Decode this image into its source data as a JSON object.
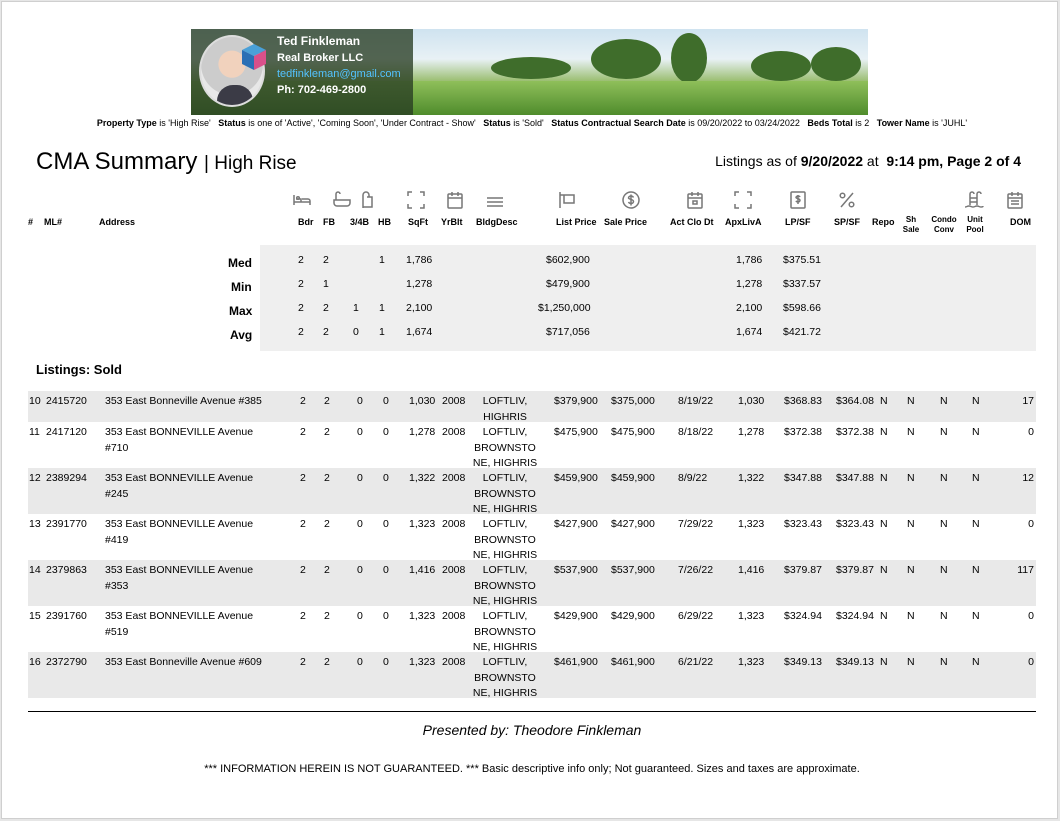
{
  "agent": {
    "name": "Ted Finkleman",
    "brokerage": "Real Broker LLC",
    "email": "tedfinkleman@gmail.com",
    "phone": "Ph: 702-469-2800"
  },
  "criteria": {
    "k1": "Property Type",
    "v1": " is 'High Rise'",
    "k2": "Status",
    "v2": " is one of 'Active', 'Coming Soon', 'Under Contract - Show'",
    "k3": "Status",
    "v3": " is 'Sold'",
    "k4": "Status Contractual Search Date",
    "v4": " is 09/20/2022 to 03/24/2022",
    "k5": "Beds Total",
    "v5": " is 2",
    "k6a": "Tower",
    "k6b": "Name",
    "v6": " is 'JUHL'"
  },
  "title": "CMA Summary",
  "subtitle": "| High Rise",
  "asof": {
    "prefix": "Listings as of ",
    "date": "9/20/2022",
    "mid": " at ",
    "time_page": "9:14 pm, Page 2 of 4"
  },
  "columns": {
    "num": "#",
    "ml": "ML#",
    "address": "Address",
    "bdr": "Bdr",
    "fb": "FB",
    "tqb": "3/4B",
    "hb": "HB",
    "sqft": "SqFt",
    "yrblt": "YrBlt",
    "bldg": "BldgDesc",
    "list": "List Price",
    "sale": "Sale Price",
    "actclo": "Act Clo Dt",
    "apxliva": "ApxLivA",
    "lpsf": "LP/SF",
    "spsf": "SP/SF",
    "repo": "Repo",
    "sh1": "Sh",
    "sh2": "Sale",
    "cc1": "Condo",
    "cc2": "Conv",
    "up1": "Unit",
    "up2": "Pool",
    "dom": "DOM"
  },
  "icons": [
    "bed-icon",
    "bath-icon",
    "shower-icon",
    "sqft-icon",
    "calendar-icon",
    "building-desc-icon",
    "list-price-sign-icon",
    "dollar-circle-icon",
    "close-date-icon",
    "living-area-icon",
    "dollar-doc-icon",
    "percent-icon",
    "pool-icon",
    "dom-calendar-icon"
  ],
  "stats": {
    "med": {
      "label": "Med",
      "bdr": "2",
      "fb": "2",
      "tqb": "",
      "hb": "1",
      "sqft": "1,786",
      "list": "$602,900",
      "apx": "1,786",
      "lpsf": "$375.51"
    },
    "min": {
      "label": "Min",
      "bdr": "2",
      "fb": "1",
      "tqb": "",
      "hb": "",
      "sqft": "1,278",
      "list": "$479,900",
      "apx": "1,278",
      "lpsf": "$337.57"
    },
    "max": {
      "label": "Max",
      "bdr": "2",
      "fb": "2",
      "tqb": "1",
      "hb": "1",
      "sqft": "2,100",
      "list": "$1,250,000",
      "apx": "2,100",
      "lpsf": "$598.66"
    },
    "avg": {
      "label": "Avg",
      "bdr": "2",
      "fb": "2",
      "tqb": "0",
      "hb": "1",
      "sqft": "1,674",
      "list": "$717,056",
      "apx": "1,674",
      "lpsf": "$421.72"
    }
  },
  "section_label": "Listings: Sold",
  "listings": [
    {
      "n": "10",
      "ml": "2415720",
      "addr": "353 East Bonneville Avenue #385",
      "bdr": "2",
      "fb": "2",
      "tqb": "0",
      "hb": "0",
      "sqft": "1,030",
      "yr": "2008",
      "bldg": "LOFTLIV, HIGHRIS",
      "list": "$379,900",
      "sale": "$375,000",
      "clo": "8/19/22",
      "apx": "1,030",
      "lpsf": "$368.83",
      "spsf": "$364.08",
      "repo": "N",
      "sh": "N",
      "cc": "N",
      "up": "N",
      "dom": "17"
    },
    {
      "n": "11",
      "ml": "2417120",
      "addr": "353 East BONNEVILLE Avenue #710",
      "bdr": "2",
      "fb": "2",
      "tqb": "0",
      "hb": "0",
      "sqft": "1,278",
      "yr": "2008",
      "bldg": "LOFTLIV, BROWNSTO NE, HIGHRIS",
      "list": "$475,900",
      "sale": "$475,900",
      "clo": "8/18/22",
      "apx": "1,278",
      "lpsf": "$372.38",
      "spsf": "$372.38",
      "repo": "N",
      "sh": "N",
      "cc": "N",
      "up": "N",
      "dom": "0"
    },
    {
      "n": "12",
      "ml": "2389294",
      "addr": "353 East BONNEVILLE Avenue #245",
      "bdr": "2",
      "fb": "2",
      "tqb": "0",
      "hb": "0",
      "sqft": "1,322",
      "yr": "2008",
      "bldg": "LOFTLIV, BROWNSTO NE, HIGHRIS",
      "list": "$459,900",
      "sale": "$459,900",
      "clo": "8/9/22",
      "apx": "1,322",
      "lpsf": "$347.88",
      "spsf": "$347.88",
      "repo": "N",
      "sh": "N",
      "cc": "N",
      "up": "N",
      "dom": "12"
    },
    {
      "n": "13",
      "ml": "2391770",
      "addr": "353 East BONNEVILLE Avenue #419",
      "bdr": "2",
      "fb": "2",
      "tqb": "0",
      "hb": "0",
      "sqft": "1,323",
      "yr": "2008",
      "bldg": "LOFTLIV, BROWNSTO NE, HIGHRIS",
      "list": "$427,900",
      "sale": "$427,900",
      "clo": "7/29/22",
      "apx": "1,323",
      "lpsf": "$323.43",
      "spsf": "$323.43",
      "repo": "N",
      "sh": "N",
      "cc": "N",
      "up": "N",
      "dom": "0"
    },
    {
      "n": "14",
      "ml": "2379863",
      "addr": "353 East BONNEVILLE Avenue #353",
      "bdr": "2",
      "fb": "2",
      "tqb": "0",
      "hb": "0",
      "sqft": "1,416",
      "yr": "2008",
      "bldg": "LOFTLIV, BROWNSTO NE, HIGHRIS",
      "list": "$537,900",
      "sale": "$537,900",
      "clo": "7/26/22",
      "apx": "1,416",
      "lpsf": "$379.87",
      "spsf": "$379.87",
      "repo": "N",
      "sh": "N",
      "cc": "N",
      "up": "N",
      "dom": "117"
    },
    {
      "n": "15",
      "ml": "2391760",
      "addr": "353 East BONNEVILLE Avenue #519",
      "bdr": "2",
      "fb": "2",
      "tqb": "0",
      "hb": "0",
      "sqft": "1,323",
      "yr": "2008",
      "bldg": "LOFTLIV, BROWNSTO NE, HIGHRIS",
      "list": "$429,900",
      "sale": "$429,900",
      "clo": "6/29/22",
      "apx": "1,323",
      "lpsf": "$324.94",
      "spsf": "$324.94",
      "repo": "N",
      "sh": "N",
      "cc": "N",
      "up": "N",
      "dom": "0"
    },
    {
      "n": "16",
      "ml": "2372790",
      "addr": "353 East Bonneville Avenue #609",
      "bdr": "2",
      "fb": "2",
      "tqb": "0",
      "hb": "0",
      "sqft": "1,323",
      "yr": "2008",
      "bldg": "LOFTLIV, BROWNSTO NE, HIGHRIS",
      "list": "$461,900",
      "sale": "$461,900",
      "clo": "6/21/22",
      "apx": "1,323",
      "lpsf": "$349.13",
      "spsf": "$349.13",
      "repo": "N",
      "sh": "N",
      "cc": "N",
      "up": "N",
      "dom": "0"
    }
  ],
  "footer": {
    "presented": "Presented by: Theodore Finkleman",
    "disclaimer": "*** INFORMATION HEREIN IS NOT GUARANTEED. ***   Basic descriptive info only; Not guaranteed. Sizes and taxes are approximate."
  }
}
